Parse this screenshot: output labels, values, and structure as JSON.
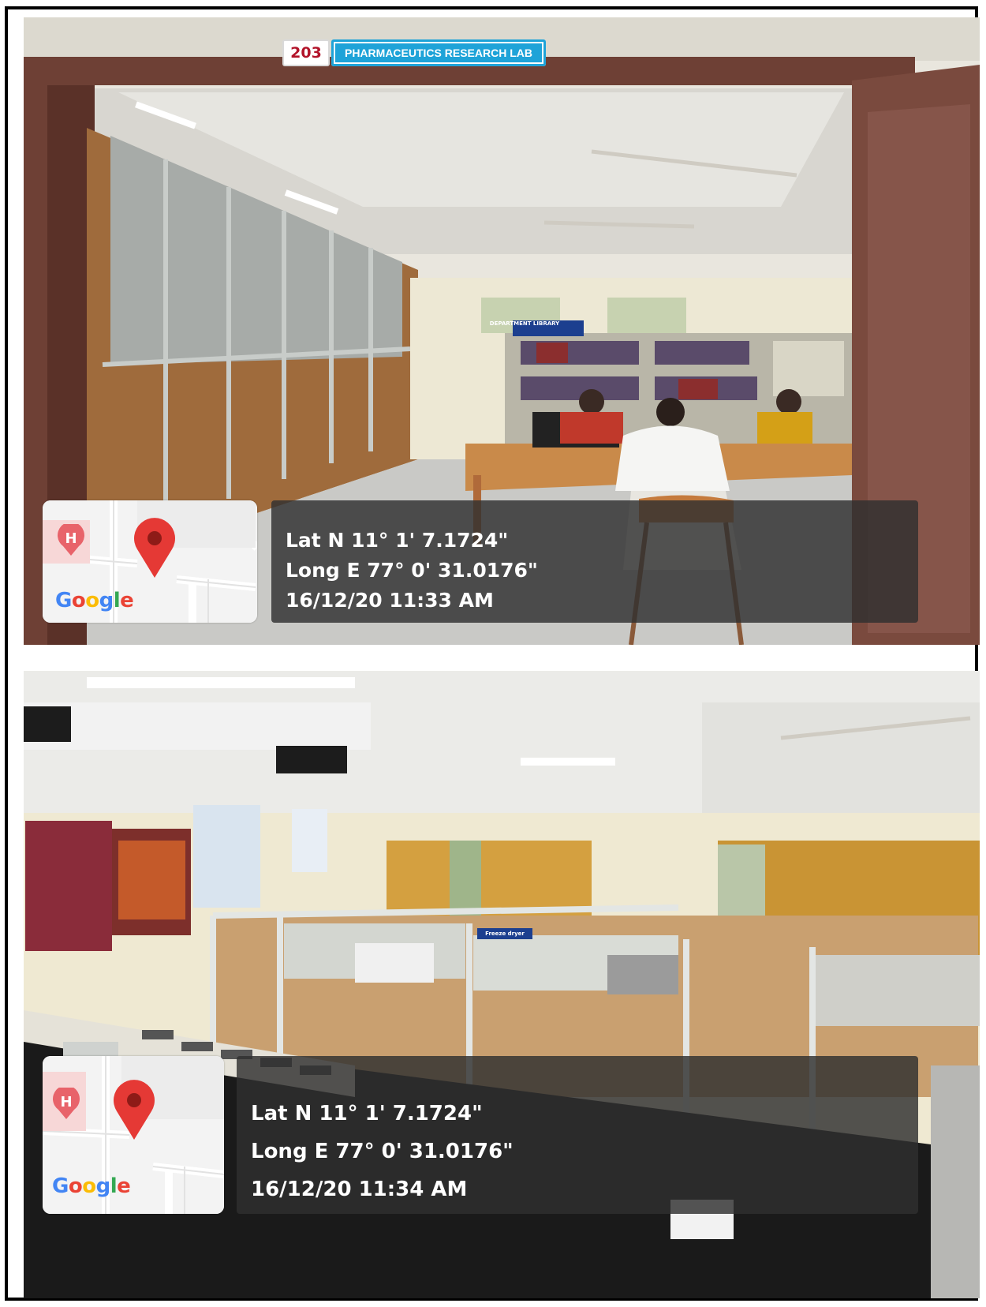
{
  "photos": [
    {
      "door_sign": {
        "room_number": "203",
        "room_name": "PHARMACEUTICS RESEARCH LAB"
      },
      "wall_sign": "DEPARTMENT LIBRARY",
      "map": {
        "logo": "Google",
        "pin_icon": "map-pin-icon",
        "hospital_icon": "hospital-marker-icon",
        "hospital_letter": "H"
      },
      "geotag": {
        "latitude": "Lat N 11° 1' 7.1724\"",
        "longitude": "Long E 77° 0' 31.0176\"",
        "datetime": "16/12/20 11:33 AM"
      }
    },
    {
      "lab_sign": "Freeze dryer",
      "map": {
        "logo": "Google",
        "pin_icon": "map-pin-icon",
        "hospital_icon": "hospital-marker-icon",
        "hospital_letter": "H"
      },
      "geotag": {
        "latitude": "Lat N 11° 1' 7.1724\"",
        "longitude": "Long E 77° 0' 31.0176\"",
        "datetime": "16/12/20 11:34 AM"
      }
    }
  ],
  "colors": {
    "google_blue": "#4285F4",
    "google_red": "#EA4335",
    "google_yellow": "#FBBC05",
    "google_green": "#34A853",
    "pin_red": "#e53935",
    "room_number_red": "#b2142a",
    "sign_blue": "#1ea3d8",
    "door_brown": "#7a4a3e"
  }
}
